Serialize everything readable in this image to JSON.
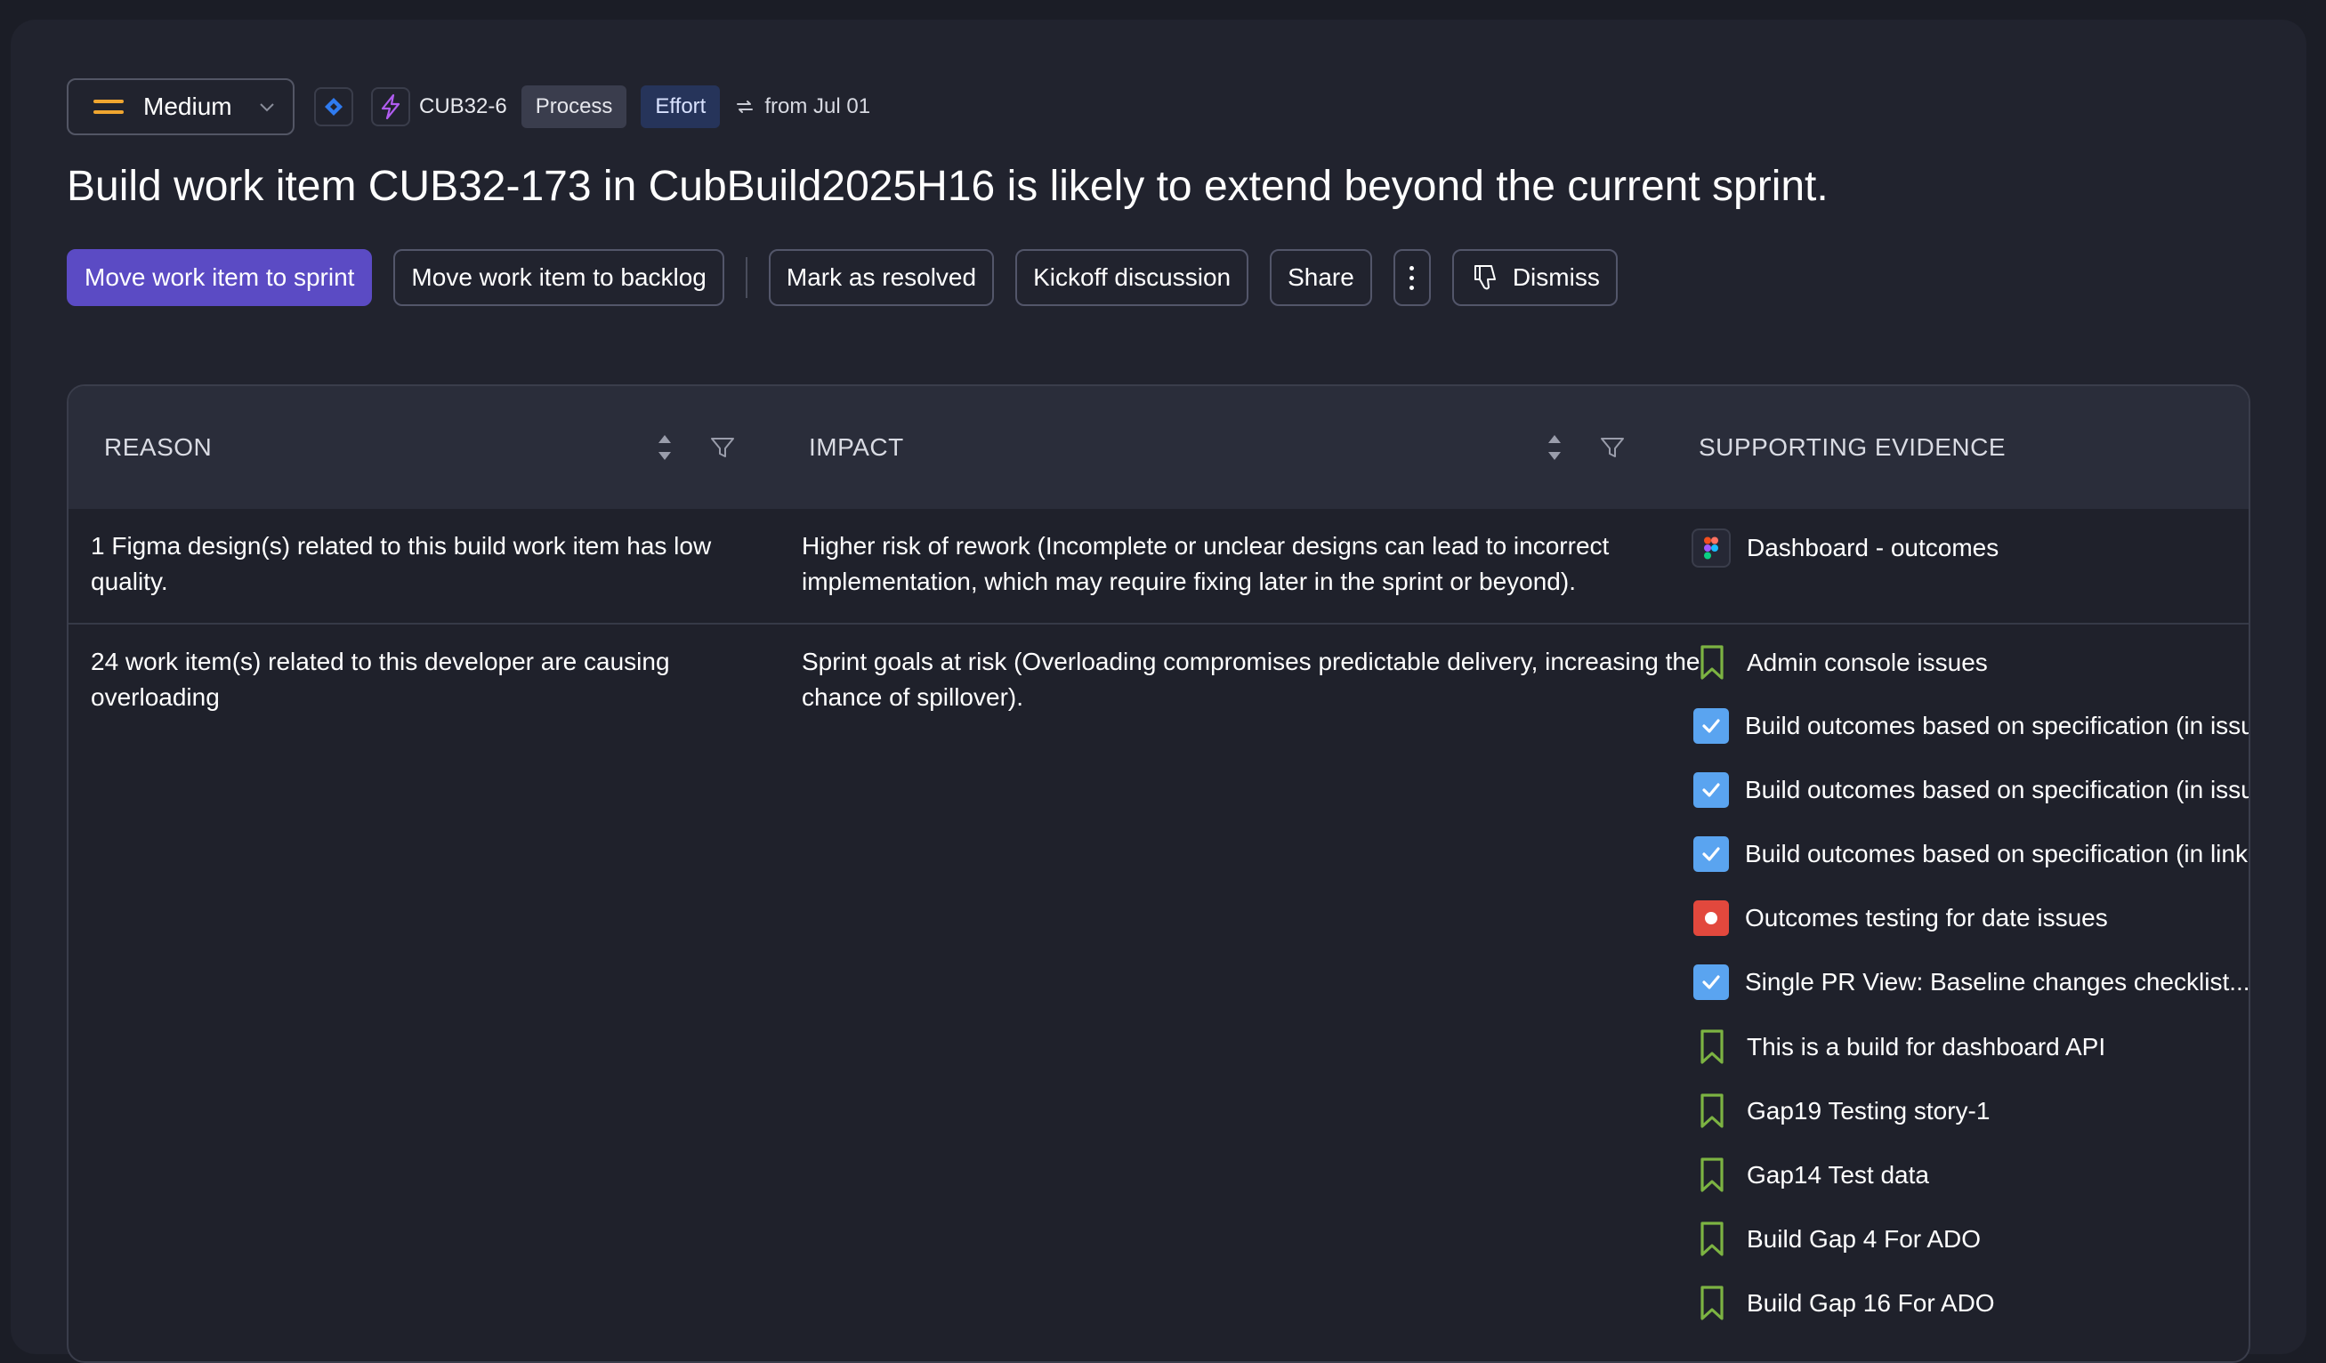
{
  "header": {
    "priority_label": "Medium",
    "issue_key": "CUB32-6",
    "tags": [
      "Process",
      "Effort"
    ],
    "from_text": "from Jul 01",
    "title": "Build work item CUB32-173 in CubBuild2025H16 is likely to extend beyond the current sprint."
  },
  "actions": {
    "move_to_sprint": "Move work item to sprint",
    "move_to_backlog": "Move work item to backlog",
    "mark_resolved": "Mark as resolved",
    "kickoff": "Kickoff discussion",
    "share": "Share",
    "dismiss": "Dismiss"
  },
  "table": {
    "columns": [
      "REASON",
      "IMPACT",
      "SUPPORTING EVIDENCE"
    ],
    "rows": [
      {
        "reason": "1 Figma design(s) related to this build work item has low quality.",
        "impact": "Higher risk of rework (Incomplete or unclear designs can lead to incorrect implementation, which may require fixing later in the sprint or beyond).",
        "evidence": [
          {
            "icon": "figma-icon",
            "label": "Dashboard - outcomes"
          }
        ]
      },
      {
        "reason": "24 work item(s) related to this developer are causing overloading",
        "impact": "Sprint goals at risk (Overloading compromises predictable delivery, increasing the chance of spillover).",
        "evidence": [
          {
            "icon": "story-bookmark-icon",
            "label": "Admin console issues"
          },
          {
            "icon": "task-check-icon",
            "label": "Build outcomes based on specification (in issu"
          },
          {
            "icon": "task-check-icon",
            "label": "Build outcomes based on specification (in issu"
          },
          {
            "icon": "task-check-icon",
            "label": "Build outcomes based on specification (in link"
          },
          {
            "icon": "bug-icon",
            "label": "Outcomes testing for date issues"
          },
          {
            "icon": "task-check-icon",
            "label": "Single PR View: Baseline changes checklist..."
          },
          {
            "icon": "story-bookmark-icon",
            "label": "This is a build for dashboard API"
          },
          {
            "icon": "story-bookmark-icon",
            "label": "Gap19 Testing story-1"
          },
          {
            "icon": "story-bookmark-icon",
            "label": "Gap14 Test data"
          },
          {
            "icon": "story-bookmark-icon",
            "label": "Build Gap 4 For ADO"
          },
          {
            "icon": "story-bookmark-icon",
            "label": "Build Gap 16 For ADO"
          }
        ]
      }
    ]
  },
  "colors": {
    "primary_button": "#5b4bc4",
    "story_icon": "#7cb342",
    "task_icon": "#5aa4f0",
    "bug_icon": "#e2483d",
    "priority_medium": "#f0a630"
  }
}
